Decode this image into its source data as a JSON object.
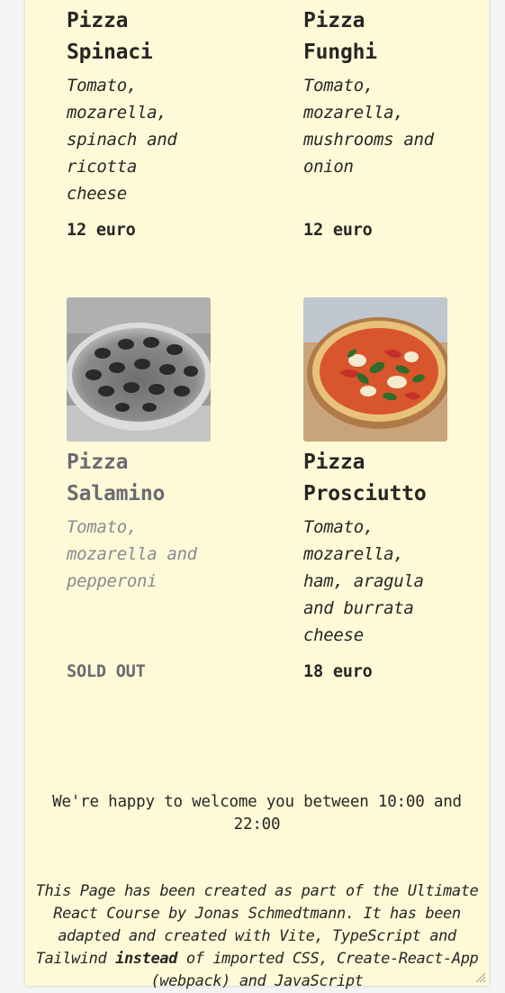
{
  "menu": {
    "pizzas": [
      {
        "name_line1": "Pizza",
        "name_line2": "Spinaci",
        "ingredients": "Tomato, mozarella, spinach and ricotta cheese",
        "price": "12 euro",
        "sold_out": false
      },
      {
        "name_line1": "Pizza",
        "name_line2": "Funghi",
        "ingredients": "Tomato, mozarella, mushrooms and onion",
        "price": "12 euro",
        "sold_out": false
      },
      {
        "name_line1": "Pizza",
        "name_line2": "Salamino",
        "ingredients": "Tomato, mozarella and pepperoni",
        "price": "SOLD OUT",
        "sold_out": true
      },
      {
        "name_line1": "Pizza",
        "name_line2": "Prosciutto",
        "ingredients": "Tomato, mozarella, ham, aragula and burrata cheese",
        "price": "18 euro",
        "sold_out": false
      }
    ]
  },
  "footer": {
    "welcome": "We're happy to welcome you between 10:00 and 22:00",
    "credits_part1": "This Page has been created as part of the Ultimate React Course by Jonas Schmedtmann. It has been adapted and created with Vite, TypeScript and Tailwind ",
    "credits_emphasis": "instead",
    "credits_part2": " of imported CSS, Create-React-App (webpack) and JavaScript"
  },
  "colors": {
    "page_background": "#fefad8",
    "outer_background": "#f4f4f4",
    "text": "#292524",
    "sold_out_text": "#6b6b72"
  }
}
